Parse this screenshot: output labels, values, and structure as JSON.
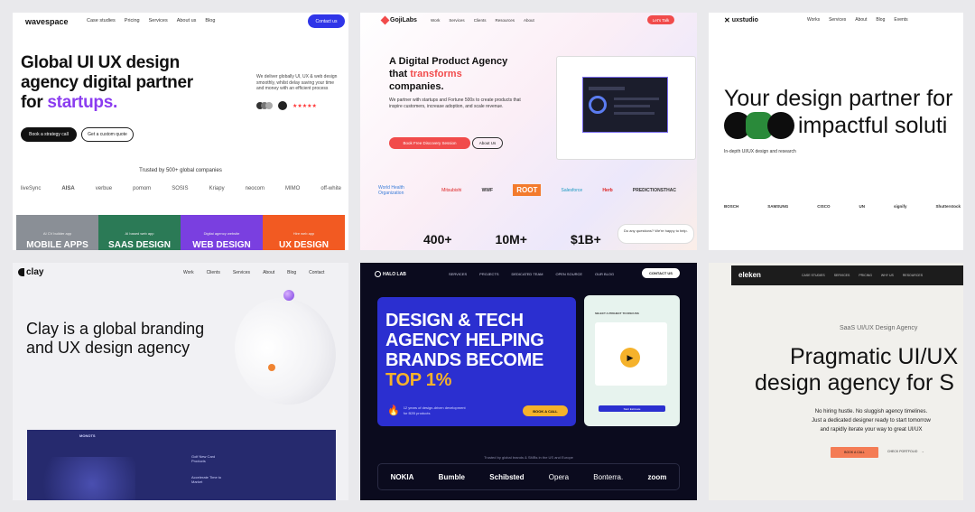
{
  "colors": {
    "wavespace_blue": "#2f35e8",
    "wavespace_purple": "#8b3cf0",
    "goji_red": "#f14b4b",
    "clay_orange": "#f08432",
    "halo_blue": "#2b2fd0",
    "halo_yellow": "#f5b22b",
    "eleken_orange": "#f47c55"
  },
  "wavespace": {
    "logo": "wavespace",
    "nav": [
      "Case studies",
      "Pricing",
      "Services",
      "About us",
      "Blog"
    ],
    "cta": "Contact us",
    "headline_1": "Global UI UX design",
    "headline_2": "agency digital partner",
    "headline_3a": "for ",
    "headline_3b": "startups.",
    "desc": "We deliver globally UI, UX & web design smoothly, whilst delay saving your time and money with an efficient process",
    "rating": "★★★★★",
    "btn_primary": "Book a strategy call",
    "btn_secondary": "Get a custom quote",
    "trusted": "Trusted by 500+ global companies",
    "logos": [
      "liveSync",
      "AISA",
      "verbue",
      "pomom",
      "SOSIS",
      "Kriapy",
      "neocom",
      "MIMO",
      "off-white"
    ],
    "cards": [
      {
        "label": "MOBILE APPS",
        "small": "AI CV builder app",
        "color": "#8a8f96"
      },
      {
        "label": "SAAS DESIGN",
        "small": "AI based web app",
        "color": "#2b7a56"
      },
      {
        "label": "WEB DESIGN",
        "small": "Digital agency website",
        "color": "#7a3fe0"
      },
      {
        "label": "UX DESIGN",
        "small": "Hire web app",
        "color": "#f25a22"
      }
    ]
  },
  "gojilabs": {
    "logo": "GojiLabs",
    "nav": [
      "Work",
      "Services",
      "Clients",
      "Resources",
      "About"
    ],
    "cta": "Let's Talk",
    "headline_1": "A Digital Product Agency",
    "headline_2a": "that ",
    "headline_2b": "transforms",
    "headline_3": "companies.",
    "desc": "We partner with startups and Fortune 500s to create products that inspire customers, increase adoption, and scale revenue.",
    "btn_primary": "Book Free Discovery Session",
    "btn_secondary": "About Us",
    "logos": [
      "World Health Organization",
      "Mitsubishi",
      "WWF",
      "ROOT",
      "Salesforce",
      "Herb",
      "PREDICTIONSTHAC"
    ],
    "stats": [
      "400+",
      "10M+",
      "$1B+"
    ],
    "chat": "Do any questions? We're happy to help."
  },
  "uxstudio": {
    "logo": "uxstudio",
    "nav": [
      "Works",
      "Services",
      "About",
      "Blog",
      "Events"
    ],
    "headline_1": "Your design partner for",
    "headline_2": "impactful soluti",
    "sub": "In-depth UI/UX design and research",
    "logos": [
      "BOSCH",
      "SAMSUNG",
      "CISCO",
      "UN",
      "signify",
      "Shutterstock"
    ]
  },
  "clay": {
    "logo": "clay",
    "nav": [
      "Work",
      "Clients",
      "Services",
      "About",
      "Blog",
      "Contact"
    ],
    "headline_1": "Clay is a global branding",
    "headline_2": "and UX design agency",
    "inner_logo": "MONOTS",
    "inner_text_1": "Golf New Card Products",
    "inner_text_2": "Accelerate Time to Market"
  },
  "halolab": {
    "logo": "HALO LAB",
    "nav": [
      "SERVICES",
      "PROJECTS",
      "DEDICATED TEAM",
      "OPEN SOURCE",
      "OUR BLOG"
    ],
    "cta": "CONTACT US",
    "headline": [
      "DESIGN & TECH",
      "AGENCY HELPING",
      "BRANDS BECOME"
    ],
    "highlight": "TOP 1%",
    "years": "12 years of design-driven development for B2B products",
    "book": "BOOK A CALL",
    "trusted": "Trusted by global brands & SMBs in the US and Europe",
    "logos": [
      "NOKIA",
      "Bumble",
      "Schibsted",
      "Opera",
      "Bonterra.",
      "zoom"
    ],
    "phone_title": "SELECT A PROJECT TO DISCUSS",
    "phone_btn": "Start Estimate"
  },
  "eleken": {
    "logo": "eleken",
    "nav": [
      "CASE STUDIES",
      "SERVICES",
      "PRICING",
      "WHY US",
      "RESOURCES"
    ],
    "small": "SaaS UI/UX Design Agency",
    "headline_1": "Pragmatic UI/UX",
    "headline_2": "design agency for S",
    "body_1": "No hiring hustle. No sluggish agency timelines.",
    "body_2": "Just a dedicated designer ready to start tomorrow",
    "body_3": "and rapidly iterate your way to great UI/UX",
    "btn_primary": "BOOK A CALL",
    "btn_secondary": "CHECK PORTFOLIO"
  }
}
